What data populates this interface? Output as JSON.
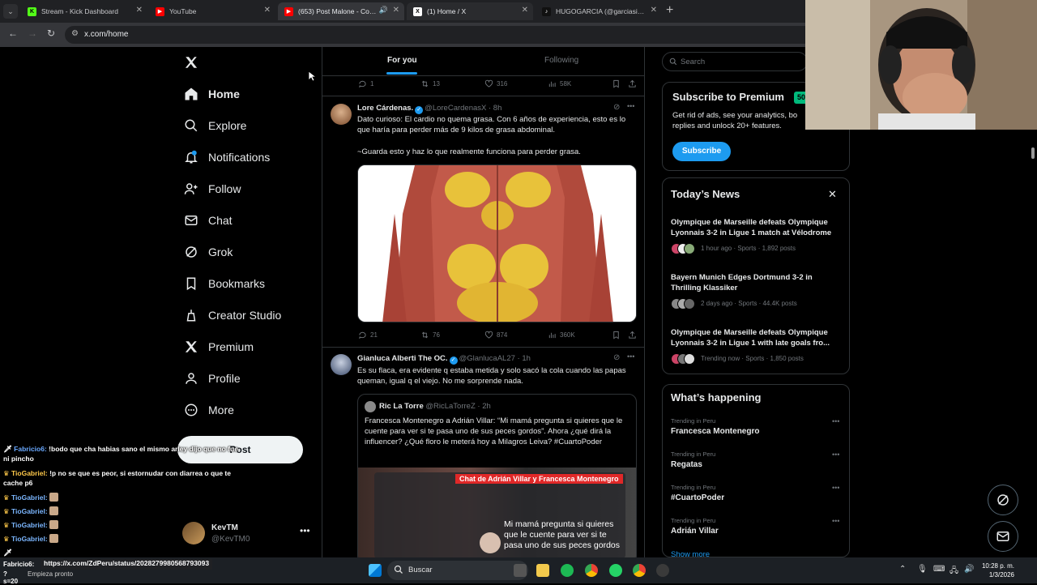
{
  "browser": {
    "tabs": [
      {
        "label": "Stream - Kick Dashboard",
        "icon": "kick-icon",
        "color": "#53fc18"
      },
      {
        "label": "YouTube",
        "icon": "youtube-icon",
        "color": "#ff0000"
      },
      {
        "label": "(653) Post Malone - Congra",
        "icon": "youtube-icon",
        "color": "#ff0000",
        "active": true
      },
      {
        "label": "(1) Home / X",
        "icon": "x-icon",
        "color": "#ffffff",
        "active": true
      },
      {
        "label": "HUGOGARCIA (@garciasilvahug",
        "icon": "tiktok-icon",
        "color": "#000000"
      }
    ],
    "url": "x.com/home"
  },
  "nav": {
    "items": [
      {
        "label": "Home",
        "icon": "home-icon"
      },
      {
        "label": "Explore",
        "icon": "search-icon"
      },
      {
        "label": "Notifications",
        "icon": "bell-icon",
        "badge": "1"
      },
      {
        "label": "Follow",
        "icon": "add-person-icon"
      },
      {
        "label": "Chat",
        "icon": "mail-icon"
      },
      {
        "label": "Grok",
        "icon": "grok-icon"
      },
      {
        "label": "Bookmarks",
        "icon": "bookmark-icon"
      },
      {
        "label": "Creator Studio",
        "icon": "creator-icon"
      },
      {
        "label": "Premium",
        "icon": "x-icon"
      },
      {
        "label": "Profile",
        "icon": "person-icon"
      },
      {
        "label": "More",
        "icon": "more-circle-icon"
      }
    ],
    "post_label": "Post",
    "profile": {
      "name": "KevTM",
      "handle": "@KevTM0"
    }
  },
  "feed": {
    "tabs": [
      "For you",
      "Following"
    ],
    "top_actions": {
      "replies": "1",
      "reposts": "13",
      "likes": "316",
      "views": "58K"
    },
    "posts": [
      {
        "name": "Lore Cárdenas.",
        "handle": "@LoreCardenasX",
        "time": "· 8h",
        "text1": "Dato curioso: El cardio no quema grasa. Con 6 años de experiencia, esto es lo que haría para perder más de 9 kilos de grasa abdominal.",
        "text2": "~Guarda esto y haz lo que realmente funciona para perder grasa.",
        "actions": {
          "replies": "21",
          "reposts": "76",
          "likes": "874",
          "views": "360K"
        }
      },
      {
        "name": "Gianluca Alberti The OC.",
        "handle": "@GlanlucaAL27",
        "time": "· 1h",
        "text1": "Es su flaca, era evidente q estaba metida y solo sacó la cola cuando las papas queman, igual q el viejo. No me sorprende nada.",
        "quote": {
          "name": "Ric La Torre",
          "handle": "@RicLaTorreZ",
          "time": "· 2h",
          "text": "Francesca Montenegro a Adrián Villar: “Mi mamá pregunta si quieres que le cuente para ver si te pasa uno de sus peces gordos”. Ahora ¿qué dirá la influencer? ¿Qué floro le meterá hoy a Milagros Leiva? #CuartoPoder",
          "media_banner": "Chat de Adrián Villar y Francesca Montenegro",
          "media_caption": "Mi mamá pregunta si quieres que le cuente para ver si te pasa uno de sus peces gordos"
        }
      }
    ]
  },
  "right": {
    "search_placeholder": "Search",
    "premium": {
      "title": "Subscribe to Premium",
      "badge": "50",
      "desc": "Get rid of ads, see your analytics, bo replies and unlock 20+ features.",
      "button": "Subscribe"
    },
    "news": {
      "title": "Today’s News",
      "items": [
        {
          "headline": "Olympique de Marseille defeats Olympique Lyonnais 3-2 in Ligue 1 match at Vélodrome",
          "meta": "1 hour ago · Sports · 1,892 posts"
        },
        {
          "headline": "Bayern Munich Edges Dortmund 3-2 in Thrilling Klassiker",
          "meta": "2 days ago · Sports · 44.4K posts"
        },
        {
          "headline": "Olympique de Marseille defeats Olympique Lyonnais 3-2 in Ligue 1 with late goals fro...",
          "meta": "Trending now · Sports · 1,850 posts"
        }
      ]
    },
    "happening": {
      "title": "What’s happening",
      "trends": [
        {
          "context": "Trending in Peru",
          "name": "Francesca Montenegro"
        },
        {
          "context": "Trending in Peru",
          "name": "Regatas"
        },
        {
          "context": "Trending in Peru",
          "name": "#CuartoPoder"
        },
        {
          "context": "Trending in Peru",
          "name": "Adrián Villar"
        }
      ],
      "show_more": "Show more"
    }
  },
  "chat": {
    "lines": [
      {
        "user": "Fabricio6:",
        "text": "!bodo que cha habias sano el mismo arley dijo que no fue ni pincho",
        "ucls": "u1"
      },
      {
        "user": "TioGabriel:",
        "text": "!p no se que es peor, si estornudar con diarrea o que te cache p6",
        "ucls": "u2"
      },
      {
        "user": "TioGabriel:",
        "text": "",
        "ucls": "u3"
      },
      {
        "user": "TioGabriel:",
        "text": "",
        "ucls": "u3"
      },
      {
        "user": "TioGabriel:",
        "text": "",
        "ucls": "u3"
      },
      {
        "user": "TioGabriel:",
        "text": "",
        "ucls": "u3"
      }
    ],
    "status_url": "https://x.com/ZdPeru/status/2028279980568793093",
    "last_user": "Fabricio6:"
  },
  "taskbar": {
    "search": "Buscar",
    "weather_temp": "?s=20",
    "weather_text": "Empieza pronto",
    "time": "10:28 p. m.",
    "date": "1/3/2026"
  }
}
